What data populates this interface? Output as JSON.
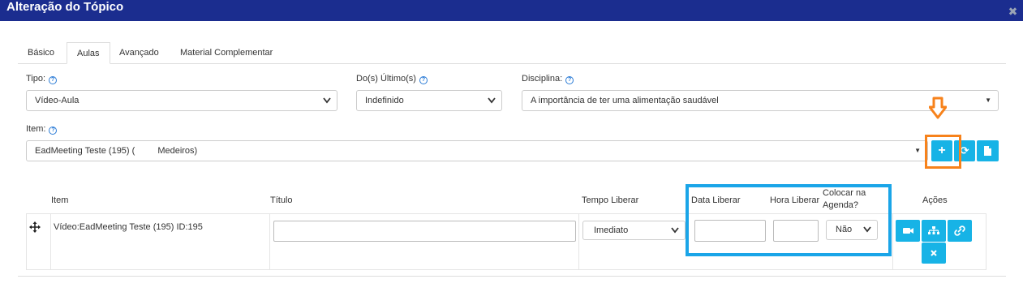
{
  "window": {
    "title": "Alteração do Tópico",
    "close_glyph": "✖"
  },
  "tabs": [
    {
      "label": "Básico",
      "active": false
    },
    {
      "label": "Aulas",
      "active": true
    },
    {
      "label": "Avançado",
      "active": false
    },
    {
      "label": "Material Complementar",
      "active": false
    }
  ],
  "form": {
    "tipo": {
      "label": "Tipo:",
      "value": "Vídeo-Aula"
    },
    "ultimos": {
      "label": "Do(s) Último(s)",
      "value": "Indefinido"
    },
    "disciplina": {
      "label": "Disciplina:",
      "value": "A importância de ter uma alimentação saudável"
    },
    "item": {
      "label": "Item:",
      "value": "EadMeeting Teste (195) (",
      "value_suffix": "Medeiros)"
    }
  },
  "item_actions": {
    "add": "+",
    "refresh": "⟳",
    "doc": "doc-icon"
  },
  "table": {
    "headers": {
      "item": "Item",
      "titulo": "Título",
      "tempo": "Tempo Liberar",
      "data": "Data Liberar",
      "hora": "Hora Liberar",
      "agenda": "Colocar na Agenda?",
      "acoes": "Ações"
    },
    "rows": [
      {
        "item": "Vídeo:EadMeeting Teste (195) ID:195",
        "titulo": "",
        "tempo": "Imediato",
        "data": "",
        "hora": "",
        "agenda": "Não"
      }
    ]
  },
  "colors": {
    "header_bg": "#1b2d8f",
    "accent": "#17b3e6",
    "highlight_orange": "#f7821b",
    "highlight_blue": "#1aa5e8"
  }
}
